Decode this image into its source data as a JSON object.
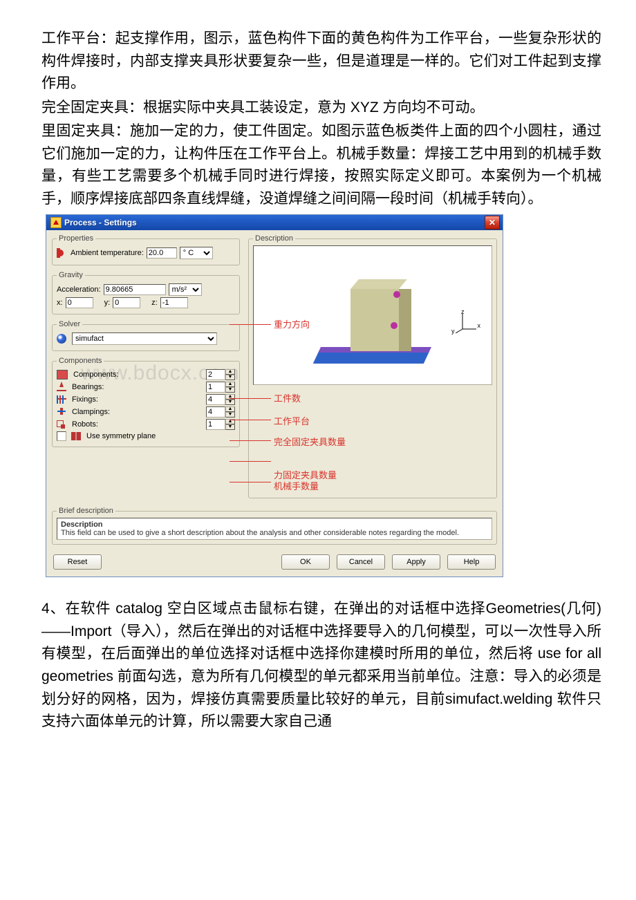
{
  "text": {
    "p1": "工作平台：起支撑作用，图示，蓝色构件下面的黄色构件为工作平台，一些复杂形状的构件焊接时，内部支撑夹具形状要复杂一些，但是道理是一样的。它们对工件起到支撑作用。",
    "p2": "完全固定夹具：根据实际中夹具工装设定，意为 XYZ 方向均不可动。",
    "p3": "里固定夹具：施加一定的力，使工件固定。如图示蓝色板类件上面的四个小圆柱，通过它们施加一定的力，让构件压在工作平台上。机械手数量：焊接工艺中用到的机械手数量，有些工艺需要多个机械手同时进行焊接，按照实际定义即可。本案例为一个机械手，顺序焊接底部四条直线焊缝，没道焊缝之间间隔一段时间（机械手转向）。",
    "p4": "4、在软件 catalog 空白区域点击鼠标右键，在弹出的对话框中选择Geometries(几何)——Import（导入），然后在弹出的对话框中选择要导入的几何模型，可以一次性导入所有模型，在后面弹出的单位选择对话框中选择你建模时所用的单位，然后将 use for all geometries 前面勾选，意为所有几何模型的单元都采用当前单位。注意：导入的必须是划分好的网格，因为，焊接仿真需要质量比较好的单元，目前simufact.welding 软件只支持六面体单元的计算，所以需要大家自己通"
  },
  "dialog": {
    "title": "Process - Settings",
    "groups": {
      "properties": "Properties",
      "gravity": "Gravity",
      "solver": "Solver",
      "components": "Components",
      "description_group": "Description",
      "brief": "Brief description"
    },
    "labels": {
      "ambient": "Ambient temperature:",
      "accel": "Acceleration:",
      "x": "x:",
      "y": "y:",
      "z": "z:",
      "components": "Components:",
      "bearings": "Bearings:",
      "fixings": "Fixings:",
      "clampings": "Clampings:",
      "robots": "Robots:",
      "symmetry": "Use symmetry plane"
    },
    "values": {
      "ambient": "20.0",
      "ambient_unit": "° C",
      "accel": "9.80665",
      "accel_unit": "m/s²",
      "x": "0",
      "y": "0",
      "z": "-1",
      "solver": "simufact",
      "components": "2",
      "bearings": "1",
      "fixings": "4",
      "clampings": "4",
      "robots": "1"
    },
    "desc": {
      "heading": "Description",
      "body": "This field can be used to give a short description about the analysis and other considerable notes regarding the model."
    },
    "buttons": {
      "reset": "Reset",
      "ok": "OK",
      "cancel": "Cancel",
      "apply": "Apply",
      "help": "Help"
    },
    "axis": {
      "x": "x",
      "y": "y",
      "z": "z"
    }
  },
  "annotations": {
    "gravity": "重力方向",
    "comp": "工件数",
    "bearing": "工作平台",
    "fixing": "完全固定夹具数量",
    "clamping": "力固定夹具数量",
    "robot": "机械手数量"
  },
  "watermark": "www.bdocx.com"
}
